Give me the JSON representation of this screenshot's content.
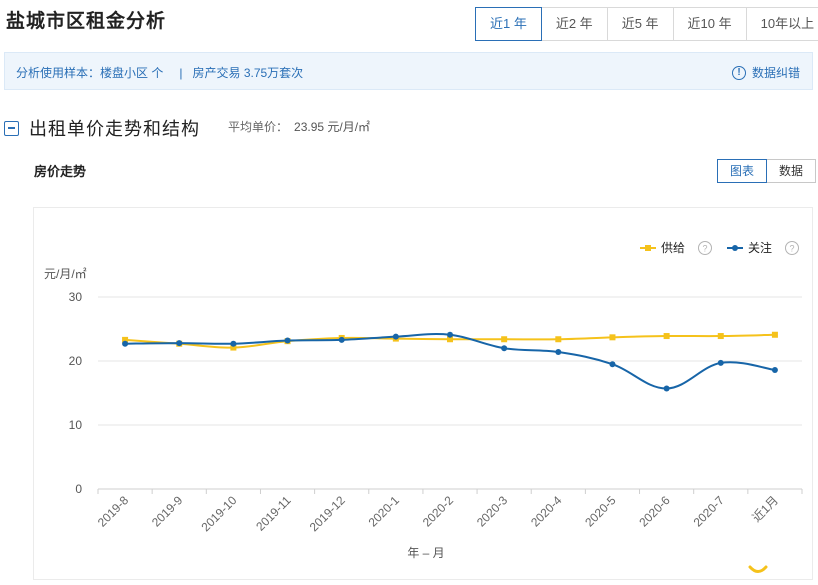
{
  "page": {
    "title": "盐城市区租金分析"
  },
  "range_tabs": [
    {
      "label": "近1 年",
      "active": true
    },
    {
      "label": "近2 年",
      "active": false
    },
    {
      "label": "近5 年",
      "active": false
    },
    {
      "label": "近10 年",
      "active": false
    },
    {
      "label": "10年以上",
      "active": false
    }
  ],
  "sample_bar": {
    "label": "分析使用样本：",
    "community": "楼盘小区 个",
    "separator": "|",
    "transactions": "房产交易 3.75万套次",
    "correction_label": "数据纠错",
    "correction_icon": "!"
  },
  "section": {
    "title": "出租单价走势和结构",
    "avg_label": "平均单价：",
    "avg_value": "23.95 元/月/㎡"
  },
  "subsection": {
    "title": "房价走势"
  },
  "view_toggle": {
    "chart_label": "图表",
    "data_label": "数据"
  },
  "colors": {
    "accent": "#2a6fb6",
    "supply": "#f5c21b",
    "attention": "#1765a8",
    "grid": "#e6e6e6"
  },
  "chart_data": {
    "type": "line",
    "categories": [
      "2019-8",
      "2019-9",
      "2019-10",
      "2019-11",
      "2019-12",
      "2020-1",
      "2020-2",
      "2020-3",
      "2020-4",
      "2020-5",
      "2020-6",
      "2020-7",
      "近1月"
    ],
    "series": [
      {
        "name": "供给",
        "marker": "square",
        "help_icon": "?",
        "values": [
          23.3,
          22.7,
          22.1,
          23.1,
          23.6,
          23.5,
          23.4,
          23.4,
          23.4,
          23.7,
          23.9,
          23.9,
          24.1
        ]
      },
      {
        "name": "关注",
        "marker": "circle",
        "help_icon": "?",
        "values": [
          22.7,
          22.8,
          22.7,
          23.2,
          23.3,
          23.8,
          24.1,
          22.0,
          21.4,
          19.5,
          15.7,
          19.7,
          18.6
        ]
      }
    ],
    "ylabel": "元/月/㎡",
    "xlabel": "年 – 月",
    "ylim": [
      0,
      30
    ],
    "yticks": [
      0,
      10,
      20,
      30
    ],
    "grid": true,
    "legend": "top-right"
  }
}
